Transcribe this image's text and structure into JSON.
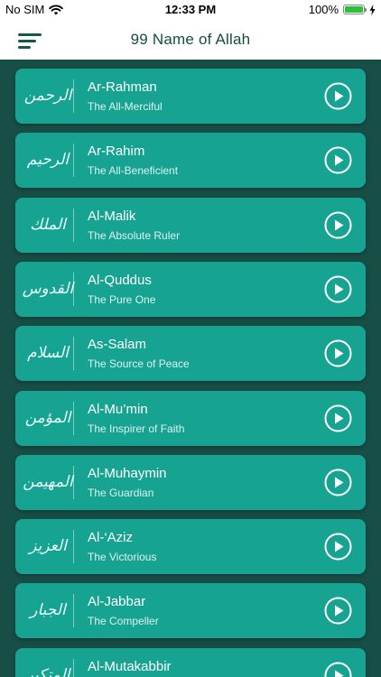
{
  "status_bar": {
    "carrier": "No SIM",
    "time": "12:33 PM",
    "battery": "100%",
    "battery_level": 1.0
  },
  "header": {
    "title": "99 Name of Allah",
    "menu_icon": "hamburger-menu-icon"
  },
  "names": [
    {
      "arabic": "الرحمن",
      "name": "Ar-Rahman",
      "meaning": "The All-Merciful"
    },
    {
      "arabic": "الرحيم",
      "name": "Ar-Rahim",
      "meaning": "The All-Beneficient"
    },
    {
      "arabic": "الملك",
      "name": "Al-Malik",
      "meaning": "The Absolute Ruler"
    },
    {
      "arabic": "القدوس",
      "name": "Al-Quddus",
      "meaning": "The Pure One"
    },
    {
      "arabic": "السلام",
      "name": "As-Salam",
      "meaning": "The Source of Peace"
    },
    {
      "arabic": "المؤمن",
      "name": "Al-Mu’min",
      "meaning": "The Inspirer of Faith"
    },
    {
      "arabic": "المهيمن",
      "name": "Al-Muhaymin",
      "meaning": "The Guardian"
    },
    {
      "arabic": "العزيز",
      "name": "Al-‘Aziz",
      "meaning": "The Victorious"
    },
    {
      "arabic": "الجبار",
      "name": "Al-Jabbar",
      "meaning": "The Compeller"
    },
    {
      "arabic": "المتكبر",
      "name": "Al-Mutakabbir",
      "meaning": ""
    }
  ],
  "play_icon": "play-icon",
  "colors": {
    "card": "#17a392",
    "background": "#174e46",
    "header_text": "#154d45"
  }
}
